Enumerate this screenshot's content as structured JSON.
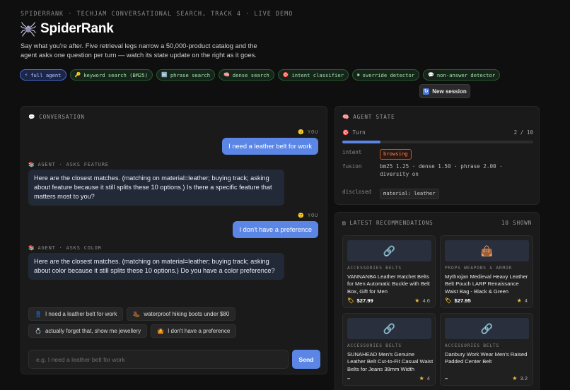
{
  "header": {
    "topline": "SPIDERRANK · TECHJAM CONVERSATIONAL SEARCH, TRACK 4 · LIVE DEMO",
    "title": "SpiderRank",
    "tagline": "Say what you're after. Five retrieval legs narrow a 50,000-product catalog and the agent asks one question per turn — watch its state update on the right as it goes.",
    "logo_icon": "spider-icon"
  },
  "chips": [
    {
      "icon": "⚡",
      "label": "full agent",
      "active": true
    },
    {
      "icon": "🔑",
      "label": "keyword search (BM25)",
      "active": false
    },
    {
      "icon": "🔤",
      "label": "phrase search",
      "active": false
    },
    {
      "icon": "🧠",
      "label": "dense search",
      "active": false
    },
    {
      "icon": "🎯",
      "label": "intent classifier",
      "active": false
    },
    {
      "icon": "⏹",
      "label": "override detector",
      "active": false
    },
    {
      "icon": "💬",
      "label": "non-answer detector",
      "active": false
    }
  ],
  "new_session": {
    "label": "New session",
    "icon": "↻"
  },
  "conversation": {
    "title": "CONVERSATION",
    "title_icon": "💬",
    "you_label": "YOU",
    "you_icon": "🙂",
    "agent_icon": "📚",
    "messages": [
      {
        "role": "user",
        "text": "I need a leather belt for work"
      },
      {
        "role": "agent",
        "label": "AGENT · ASKS FEATURE",
        "text": "Here are the closest matches. (matching on material=leather; buying track; asking about feature because it still splits these 10 options.) Is there a specific feature that matters most to you?"
      },
      {
        "role": "user",
        "text": "I don't have a preference"
      },
      {
        "role": "agent",
        "label": "AGENT · ASKS COLOR",
        "text": "Here are the closest matches. (matching on material=leather; buying track; asking about color because it still splits these 10 options.) Do you have a color preference?"
      }
    ],
    "suggestions": [
      {
        "icon": "👖",
        "label": "I need a leather belt for work"
      },
      {
        "icon": "🥾",
        "label": "waterproof hiking boots under $80"
      },
      {
        "icon": "💍",
        "label": "actually forget that, show me jewellery"
      },
      {
        "icon": "🤷",
        "label": "I don't have a preference"
      }
    ],
    "input_placeholder": "e.g. I need a leather belt for work",
    "input_value": "",
    "send_label": "Send"
  },
  "agent_state": {
    "title": "AGENT STATE",
    "title_icon": "🧠",
    "turn_label": "Turn",
    "turn_icon": "🎯",
    "turn_current": 2,
    "turn_total": 10,
    "turn_text": "2 / 10",
    "intent_key": "intent",
    "intent_value": "browsing",
    "fusion_key": "fusion",
    "fusion_value": "bm25 1.25 · dense 1.50 · phrase 2.00 · diversity on",
    "disclosed_key": "disclosed",
    "disclosed_value": "material: leather"
  },
  "recommendations": {
    "title": "LATEST RECOMMENDATIONS",
    "title_icon": "▤",
    "count_label": "10 SHOWN",
    "cards": [
      {
        "thumb": "🔗",
        "category": "ACCESSORIES BELTS",
        "name": "VANNANBA Leather Ratchet Belts for Men Automatic Buckle with Belt Box, Gift for Men",
        "price": "$27.99",
        "rating": "4.6",
        "price_icon": "🏷"
      },
      {
        "thumb": "👜",
        "category": "PROPS WEAPONS & ARMOR",
        "name": "Mythrojan Medieval Heavy Leather Belt Pouch LARP Renaissance Waist Bag - Black & Green",
        "price": "$27.95",
        "rating": "4",
        "price_icon": "🏷"
      },
      {
        "thumb": "🔗",
        "category": "ACCESSORIES BELTS",
        "name": "SUNAHEAD Men's Genuine Leather Belt Cut-to-Fit Casual Waist Belts for Jeans 38mm Width",
        "price": "–",
        "rating": "4",
        "price_icon": ""
      },
      {
        "thumb": "🔗",
        "category": "ACCESSORIES BELTS",
        "name": "Danbury Work Wear Men's Raised Padded Center Belt",
        "price": "–",
        "rating": "3.2",
        "price_icon": ""
      }
    ]
  }
}
